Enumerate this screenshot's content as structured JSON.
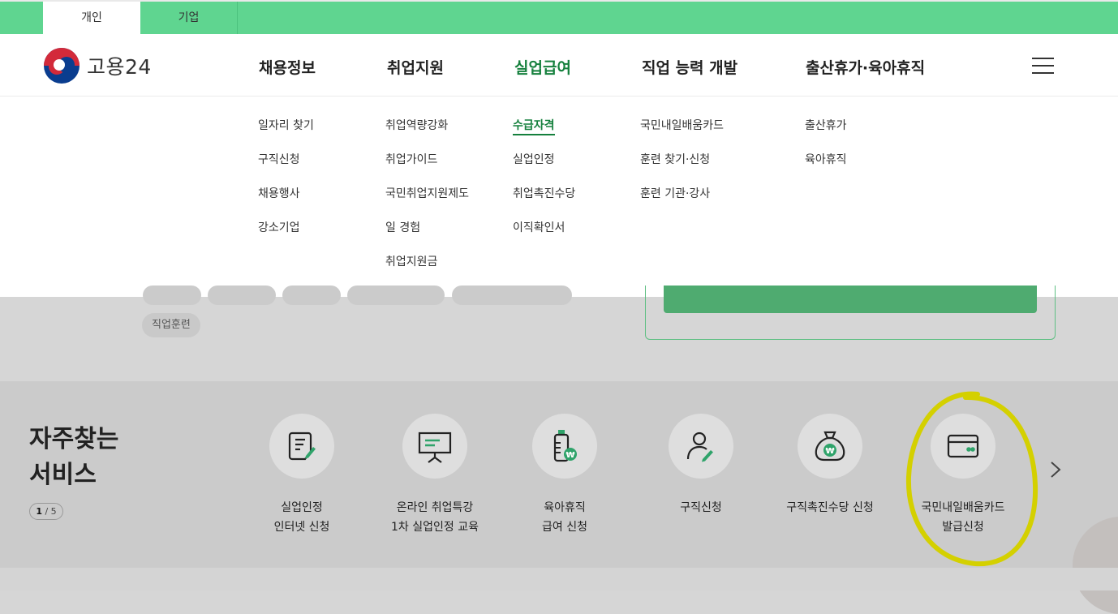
{
  "top_tabs": [
    "개인",
    "기업"
  ],
  "logo": {
    "text": "고용24"
  },
  "gnb": [
    "채용정보",
    "취업지원",
    "실업급여",
    "직업 능력 개발",
    "출산휴가·육아휴직"
  ],
  "dropdown": [
    [
      "일자리 찾기",
      "구직신청",
      "채용행사",
      "강소기업"
    ],
    [
      "취업역량강화",
      "취업가이드",
      "국민취업지원제도",
      "일 경험",
      "취업지원금"
    ],
    [
      "수급자격",
      "실업인정",
      "취업촉진수당",
      "이직확인서"
    ],
    [
      "국민내일배움카드",
      "훈련 찾기·신청",
      "훈련 기관·강사"
    ],
    [
      "출산휴가",
      "육아휴직"
    ]
  ],
  "chip_label": "직업훈련",
  "services": {
    "title": "자주찾는\n서비스",
    "pager_current": "1",
    "pager_total": "/ 5",
    "items": [
      {
        "label": "실업인정\n인터넷 신청",
        "icon": "document-pen-icon"
      },
      {
        "label": "온라인 취업특강\n1차 실업인정 교육",
        "icon": "presentation-board-icon"
      },
      {
        "label": "육아휴직\n급여 신청",
        "icon": "baby-bottle-won-icon"
      },
      {
        "label": "구직신청",
        "icon": "person-pen-icon"
      },
      {
        "label": "구직촉진수당 신청",
        "icon": "money-bag-won-icon"
      },
      {
        "label": "국민내일배움카드\n발급신청",
        "icon": "card-icon"
      }
    ]
  },
  "colors": {
    "brand_green": "#5fd590",
    "active_green": "#15803d",
    "highlight_yellow": "#d4d000"
  }
}
